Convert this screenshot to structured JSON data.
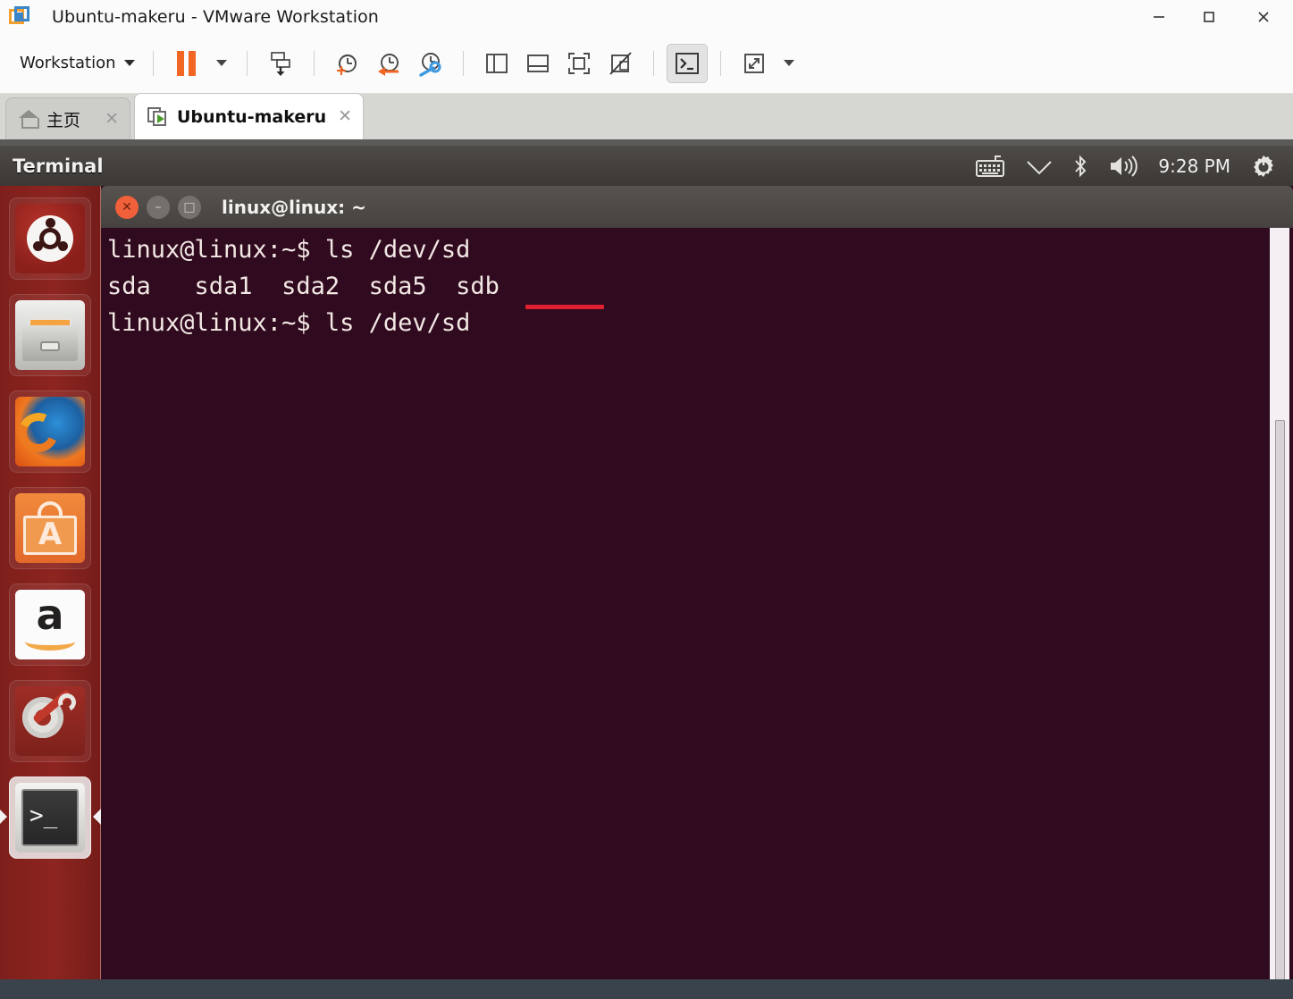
{
  "window": {
    "title": "Ubuntu-makeru - VMware Workstation",
    "app_icon": "vmware-logo-icon",
    "controls": {
      "minimize": "–",
      "maximize": "□",
      "close": "✕"
    }
  },
  "toolbar": {
    "menu_label": "Workstation",
    "buttons": [
      {
        "name": "pause-vm-button",
        "icon": "pause-icon",
        "label": "Pause"
      },
      {
        "name": "pause-dropdown-button",
        "icon": "chevron-down-icon",
        "label": ""
      },
      {
        "name": "send-ctrl-alt-del-button",
        "icon": "send-keys-icon",
        "label": ""
      },
      {
        "name": "take-snapshot-button",
        "icon": "clock-plus-icon",
        "label": ""
      },
      {
        "name": "revert-snapshot-button",
        "icon": "clock-revert-icon",
        "label": ""
      },
      {
        "name": "snapshot-manager-button",
        "icon": "clock-wrench-icon",
        "label": ""
      },
      {
        "name": "show-library-button",
        "icon": "sidebar-panel-icon",
        "label": ""
      },
      {
        "name": "show-thumbnail-bar-button",
        "icon": "bottom-panel-icon",
        "label": ""
      },
      {
        "name": "full-screen-button",
        "icon": "fullscreen-icon",
        "label": ""
      },
      {
        "name": "unity-mode-button",
        "icon": "unity-disabled-icon",
        "label": ""
      },
      {
        "name": "console-view-button",
        "icon": "terminal-prompt-icon",
        "label": ""
      },
      {
        "name": "stretch-guest-button",
        "icon": "expand-arrows-icon",
        "label": ""
      },
      {
        "name": "stretch-dropdown-button",
        "icon": "chevron-down-icon",
        "label": ""
      }
    ]
  },
  "tabs": [
    {
      "name": "tab-home",
      "label": "主页",
      "icon": "home-icon",
      "close": "✕",
      "active": false
    },
    {
      "name": "tab-ubuntu-makeru",
      "label": "Ubuntu-makeru",
      "icon": "vm-play-icon",
      "close": "✕",
      "active": true
    }
  ],
  "guest": {
    "panel": {
      "title": "Terminal",
      "clock": "9:28 PM",
      "indicators": [
        "keyboard-icon",
        "wifi-icon",
        "bluetooth-icon",
        "volume-icon"
      ],
      "session_icon": "gear-power-icon"
    },
    "launcher": [
      {
        "name": "launcher-item-ubuntu-dash",
        "icon": "ubuntu-dash-icon",
        "selected": false
      },
      {
        "name": "launcher-item-files",
        "icon": "files-nautilus-icon",
        "selected": false
      },
      {
        "name": "launcher-item-firefox",
        "icon": "firefox-icon",
        "selected": false
      },
      {
        "name": "launcher-item-software-center",
        "icon": "ubuntu-software-icon",
        "selected": false,
        "letter": "A"
      },
      {
        "name": "launcher-item-amazon",
        "icon": "amazon-icon",
        "selected": false,
        "letter": "a"
      },
      {
        "name": "launcher-item-system-settings",
        "icon": "system-settings-icon",
        "selected": false
      },
      {
        "name": "launcher-item-terminal",
        "icon": "terminal-icon",
        "selected": true,
        "prompt": ">_"
      }
    ],
    "terminal": {
      "title": "linux@linux: ~",
      "window_buttons": {
        "close": "✕",
        "minimize": "–",
        "maximize": "□"
      },
      "lines": [
        "linux@linux:~$ ls /dev/sd",
        "sda   sda1  sda2  sda5  sdb",
        "linux@linux:~$ ls /dev/sd"
      ],
      "annotation": {
        "name": "red-underline-annotation",
        "color": "#e02030",
        "targets": "sdb"
      }
    }
  },
  "colors": {
    "accent_orange": "#f26522",
    "terminal_bg": "#300a1e",
    "launcher_bg": "#8d2420",
    "panel_bg": "#46423f",
    "annotation_red": "#e02030"
  }
}
